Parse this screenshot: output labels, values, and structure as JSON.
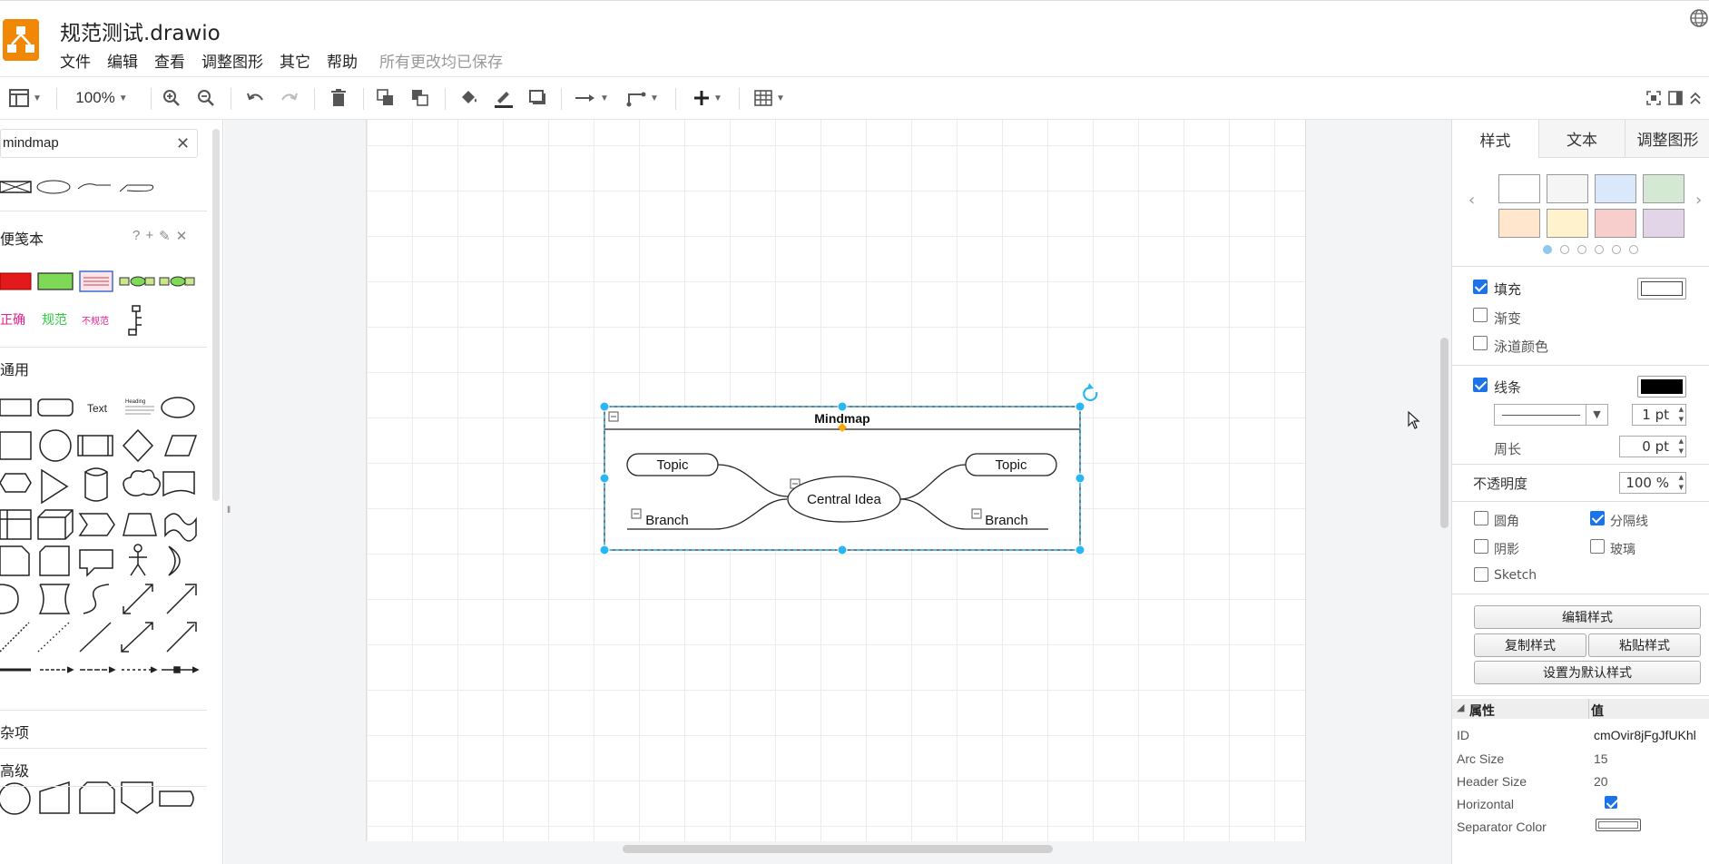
{
  "app": {
    "title": "规范测试.drawio",
    "menu": [
      "文件",
      "编辑",
      "查看",
      "调整图形",
      "其它",
      "帮助"
    ],
    "save_status": "所有更改均已保存"
  },
  "toolbar": {
    "zoom": "100%",
    "icons": [
      "view-panels-icon",
      "zoom-in-icon",
      "zoom-out-icon",
      "undo-icon",
      "redo-icon",
      "delete-icon",
      "to-front-icon",
      "to-back-icon",
      "fill-color-icon",
      "line-color-icon",
      "shadow-icon",
      "connection-icon",
      "waypoints-icon",
      "insert-icon",
      "table-icon",
      "fullscreen-icon",
      "format-panel-icon",
      "collapse-icon"
    ]
  },
  "sidebar": {
    "search_value": "mindmap",
    "clear_icon": "✕",
    "sections": {
      "scratchpad": "便笺本",
      "general": "通用",
      "misc": "杂项",
      "advanced": "高级"
    },
    "scratchpad_actions": [
      "?",
      "+",
      "✎",
      "✕"
    ],
    "scratchpad_labels": {
      "correct": "正确",
      "standard": "规范",
      "nonstandard": "不规范"
    },
    "general_text_shape": "Text",
    "general_heading_shape": "Heading"
  },
  "diagram": {
    "container_title": "Mindmap",
    "central": "Central Idea",
    "topic_left": "Topic",
    "topic_right": "Topic",
    "branch_left": "Branch",
    "branch_right": "Branch"
  },
  "format_panel": {
    "tabs": [
      "样式",
      "文本",
      "调整图形"
    ],
    "swatch_colors": [
      "#ffffff",
      "#f5f5f5",
      "#dae8fc",
      "#d5e8d4",
      "#ffe6cc",
      "#fff2cc",
      "#f8cecc",
      "#e1d5e7"
    ],
    "fill": {
      "label": "填充",
      "checked": true,
      "color": "#ffffff"
    },
    "gradient": {
      "label": "渐变",
      "checked": false
    },
    "lane_color": {
      "label": "泳道颜色",
      "checked": false
    },
    "line": {
      "label": "线条",
      "checked": true,
      "color": "#000000",
      "width": "1 pt"
    },
    "perimeter": {
      "label": "周长",
      "value": "0 pt"
    },
    "opacity": {
      "label": "不透明度",
      "value": "100 %"
    },
    "rounded": {
      "label": "圆角",
      "checked": false
    },
    "divider": {
      "label": "分隔线",
      "checked": true
    },
    "shadow": {
      "label": "阴影",
      "checked": false
    },
    "glass": {
      "label": "玻璃",
      "checked": false
    },
    "sketch": {
      "label": "Sketch",
      "checked": false
    },
    "buttons": {
      "edit_style": "编辑样式",
      "copy_style": "复制样式",
      "paste_style": "粘贴样式",
      "set_default": "设置为默认样式"
    },
    "properties": {
      "header_name": "属性",
      "header_value": "值",
      "rows": [
        {
          "name": "ID",
          "value": "cmOvir8jFgJfUKhl"
        },
        {
          "name": "Arc Size",
          "value": "15"
        },
        {
          "name": "Header Size",
          "value": "20"
        },
        {
          "name": "Horizontal",
          "value": ""
        },
        {
          "name": "Separator Color",
          "value": ""
        }
      ],
      "horizontal_checked": true
    }
  }
}
